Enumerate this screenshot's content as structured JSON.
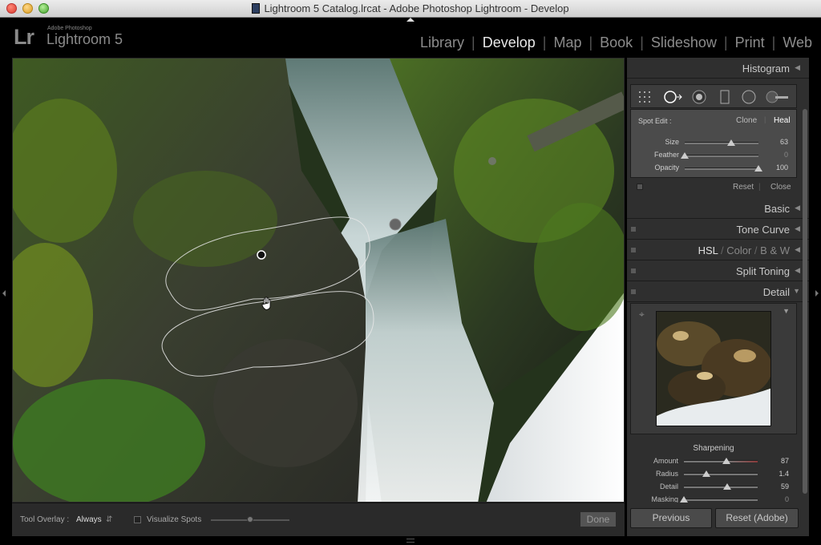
{
  "window": {
    "title": "Lightroom 5 Catalog.lrcat - Adobe Photoshop Lightroom - Develop"
  },
  "brand": {
    "small": "Adobe Photoshop",
    "name": "Lightroom 5",
    "logo": "Lr"
  },
  "modules": [
    {
      "label": "Library",
      "active": false
    },
    {
      "label": "Develop",
      "active": true
    },
    {
      "label": "Map",
      "active": false
    },
    {
      "label": "Book",
      "active": false
    },
    {
      "label": "Slideshow",
      "active": false
    },
    {
      "label": "Print",
      "active": false
    },
    {
      "label": "Web",
      "active": false
    }
  ],
  "panels": {
    "histogram": "Histogram",
    "spot": {
      "label": "Spot Edit :",
      "clone": "Clone",
      "heal": "Heal",
      "sliders": [
        {
          "label": "Size",
          "value": "63",
          "fraction": 0.63
        },
        {
          "label": "Feather",
          "value": "0",
          "fraction": 0.0
        },
        {
          "label": "Opacity",
          "value": "100",
          "fraction": 1.0
        }
      ],
      "reset": "Reset",
      "close": "Close"
    },
    "sections": [
      "Basic",
      "Tone Curve",
      "Split Toning",
      "Detail"
    ],
    "hsl": {
      "hsl": "HSL",
      "color": "Color",
      "bw": "B & W"
    },
    "sharpening": {
      "title": "Sharpening",
      "sliders": [
        {
          "label": "Amount",
          "value": "87",
          "fraction": 0.58
        },
        {
          "label": "Radius",
          "value": "1.4",
          "fraction": 0.3
        },
        {
          "label": "Detail",
          "value": "59",
          "fraction": 0.59
        },
        {
          "label": "Masking",
          "value": "0",
          "fraction": 0.0
        }
      ]
    }
  },
  "toolbar": {
    "overlay_label": "Tool Overlay :",
    "overlay_value": "Always",
    "visualize": "Visualize Spots",
    "visualize_level": 0.5,
    "done": "Done"
  },
  "buttons": {
    "previous": "Previous",
    "reset": "Reset (Adobe)"
  }
}
